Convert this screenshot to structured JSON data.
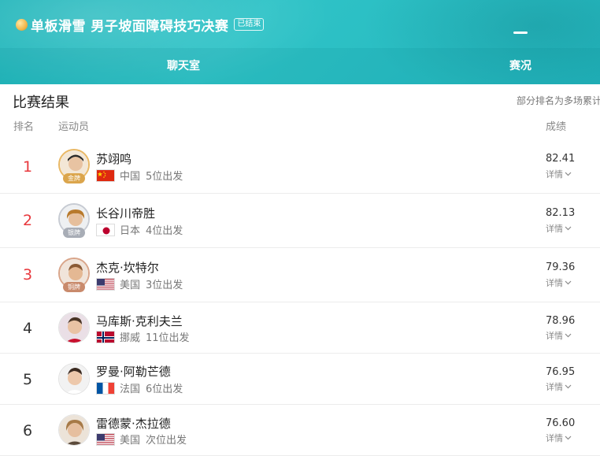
{
  "header": {
    "title": "单板滑雪 男子坡面障碍技巧决赛",
    "status": "已结束",
    "tabs": {
      "chat": "聊天室",
      "result": "赛况"
    }
  },
  "section": {
    "title": "比赛结果",
    "note": "部分排名为多场累计"
  },
  "columns": {
    "rank": "排名",
    "athlete": "运动员",
    "score": "成绩"
  },
  "medal_labels": {
    "gold": "金牌",
    "silver": "银牌",
    "bronze": "铜牌"
  },
  "detail_label": "详情",
  "results": [
    {
      "rank": "1",
      "name": "苏翊鸣",
      "country": "中国",
      "order": "5位出发",
      "score": "82.41",
      "medal": "gold",
      "flag": "cn-flag-icon"
    },
    {
      "rank": "2",
      "name": "长谷川帝胜",
      "country": "日本",
      "order": "4位出发",
      "score": "82.13",
      "medal": "silver",
      "flag": "jp-flag-icon"
    },
    {
      "rank": "3",
      "name": "杰克·坎特尔",
      "country": "美国",
      "order": "3位出发",
      "score": "79.36",
      "medal": "bronze",
      "flag": "us-flag-icon"
    },
    {
      "rank": "4",
      "name": "马库斯·克利夫兰",
      "country": "挪威",
      "order": "11位出发",
      "score": "78.96",
      "medal": "",
      "flag": "no-flag-icon"
    },
    {
      "rank": "5",
      "name": "罗曼·阿勒芒德",
      "country": "法国",
      "order": "6位出发",
      "score": "76.95",
      "medal": "",
      "flag": "fr-flag-icon"
    },
    {
      "rank": "6",
      "name": "雷德蒙·杰拉德",
      "country": "美国",
      "order": "次位出发",
      "score": "76.60",
      "medal": "",
      "flag": "us-flag-icon"
    }
  ],
  "colors": {
    "accent": "#1bb3b8",
    "top3_rank": "#e8383d"
  }
}
